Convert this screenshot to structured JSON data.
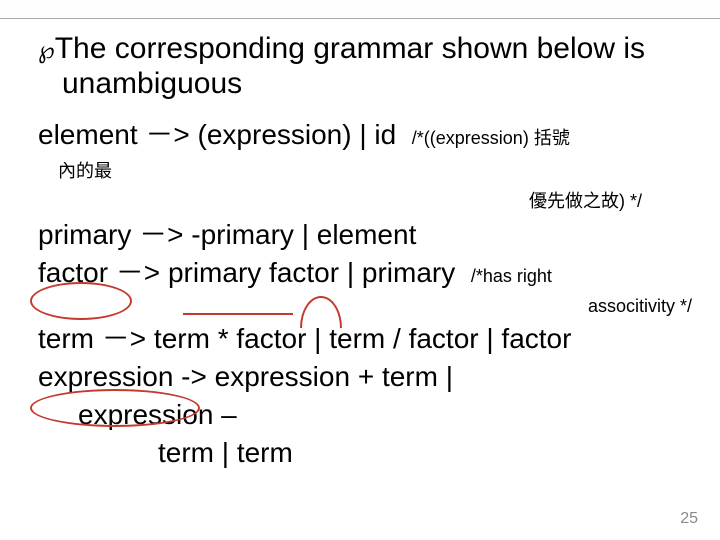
{
  "intro": "The corresponding grammar shown below is unambiguous",
  "rules": {
    "element": "element －> (expression) | id",
    "element_comment_a": "/*((expression) 括號",
    "element_note": "內的最",
    "element_comment_b": "優先做之故) */",
    "primary": "primary －> -primary | element",
    "factor": "factor －> primary  factor | primary",
    "factor_comment_a": "/*has right",
    "factor_comment_b": "associtivity */",
    "term": "term －> term * factor | term / factor | factor",
    "expr1": "expression -> expression + term |",
    "expr2": "expression –",
    "expr3": "term | term"
  },
  "page_number": "25"
}
